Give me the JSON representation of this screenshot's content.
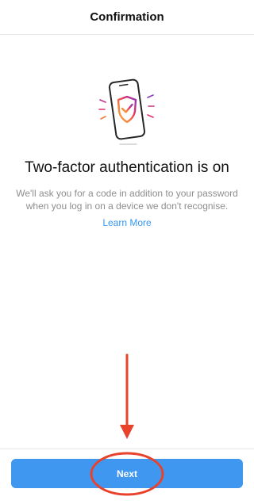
{
  "header": {
    "title": "Confirmation"
  },
  "main": {
    "illustration_icon": "phone-shield-check-icon",
    "headline": "Two-factor authentication is on",
    "description": "We'll ask you for a code in addition to your password when you log in on a device we don't recognise.",
    "learn_more_label": "Learn More"
  },
  "footer": {
    "next_label": "Next"
  },
  "colors": {
    "accent_blue": "#3f97f0",
    "link_blue": "#3897f0",
    "annotation_red": "#e8412c",
    "shield_gradient": [
      "#8a3ab9",
      "#e1306c",
      "#f77737",
      "#fcaf45"
    ]
  }
}
